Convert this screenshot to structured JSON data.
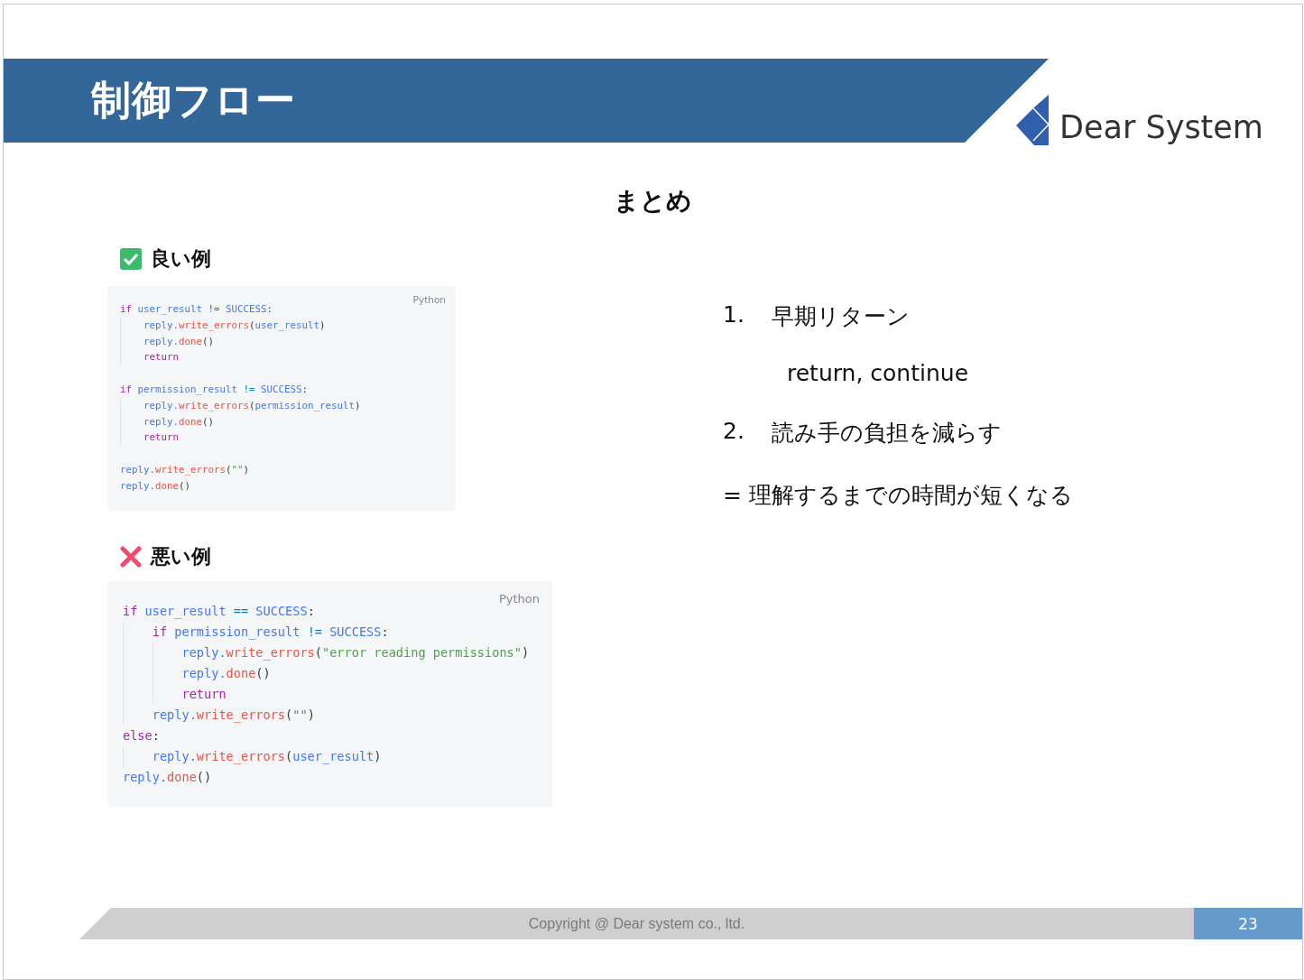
{
  "header": {
    "title": "制御フロー",
    "logo_text": "Dear System"
  },
  "heading": "まとめ",
  "examples": [
    {
      "kind": "good",
      "label": "良い例",
      "language": "Python",
      "lines": [
        {
          "kind": "code",
          "tokens": [
            {
              "kind": "keyword",
              "text": "if "
            },
            {
              "kind": "name",
              "text": "user_result "
            },
            {
              "kind": "operator",
              "text": "!= "
            },
            {
              "kind": "name",
              "text": "SUCCESS"
            },
            {
              "kind": "punct",
              "text": ":"
            }
          ],
          "children": [
            {
              "kind": "code",
              "tokens": [
                {
                  "kind": "name",
                  "text": "reply."
                },
                {
                  "kind": "function",
                  "text": "write_errors"
                },
                {
                  "kind": "punct",
                  "text": "("
                },
                {
                  "kind": "name",
                  "text": "user_result"
                },
                {
                  "kind": "punct",
                  "text": ")"
                }
              ]
            },
            {
              "kind": "code",
              "tokens": [
                {
                  "kind": "name",
                  "text": "reply."
                },
                {
                  "kind": "function",
                  "text": "done"
                },
                {
                  "kind": "punct",
                  "text": "()"
                }
              ]
            },
            {
              "kind": "code",
              "tokens": [
                {
                  "kind": "keyword",
                  "text": "return"
                }
              ]
            }
          ]
        },
        {
          "kind": "blank"
        },
        {
          "kind": "code",
          "tokens": [
            {
              "kind": "keyword",
              "text": "if "
            },
            {
              "kind": "name",
              "text": "permission_result "
            },
            {
              "kind": "operator",
              "text": "!= "
            },
            {
              "kind": "name",
              "text": "SUCCESS"
            },
            {
              "kind": "punct",
              "text": ":"
            }
          ],
          "children": [
            {
              "kind": "code",
              "tokens": [
                {
                  "kind": "name",
                  "text": "reply."
                },
                {
                  "kind": "function",
                  "text": "write_errors"
                },
                {
                  "kind": "punct",
                  "text": "("
                },
                {
                  "kind": "name",
                  "text": "permission_result"
                },
                {
                  "kind": "punct",
                  "text": ")"
                }
              ]
            },
            {
              "kind": "code",
              "tokens": [
                {
                  "kind": "name",
                  "text": "reply."
                },
                {
                  "kind": "function",
                  "text": "done"
                },
                {
                  "kind": "punct",
                  "text": "()"
                }
              ]
            },
            {
              "kind": "code",
              "tokens": [
                {
                  "kind": "keyword",
                  "text": "return"
                }
              ]
            }
          ]
        },
        {
          "kind": "blank"
        },
        {
          "kind": "code",
          "tokens": [
            {
              "kind": "name",
              "text": "reply."
            },
            {
              "kind": "function",
              "text": "write_errors"
            },
            {
              "kind": "punct",
              "text": "("
            },
            {
              "kind": "string",
              "text": "\"\""
            },
            {
              "kind": "punct",
              "text": ")"
            }
          ]
        },
        {
          "kind": "code",
          "tokens": [
            {
              "kind": "name",
              "text": "reply."
            },
            {
              "kind": "function",
              "text": "done"
            },
            {
              "kind": "punct",
              "text": "()"
            }
          ]
        }
      ]
    },
    {
      "kind": "bad",
      "label": "悪い例",
      "language": "Python",
      "lines": [
        {
          "kind": "code",
          "tokens": [
            {
              "kind": "keyword",
              "text": "if "
            },
            {
              "kind": "name",
              "text": "user_result "
            },
            {
              "kind": "operator",
              "text": "== "
            },
            {
              "kind": "name",
              "text": "SUCCESS"
            },
            {
              "kind": "punct",
              "text": ":"
            }
          ],
          "children": [
            {
              "kind": "code",
              "tokens": [
                {
                  "kind": "keyword",
                  "text": "if "
                },
                {
                  "kind": "name",
                  "text": "permission_result "
                },
                {
                  "kind": "operator",
                  "text": "!= "
                },
                {
                  "kind": "name",
                  "text": "SUCCESS"
                },
                {
                  "kind": "punct",
                  "text": ":"
                }
              ],
              "children": [
                {
                  "kind": "code",
                  "tokens": [
                    {
                      "kind": "name",
                      "text": "reply."
                    },
                    {
                      "kind": "function",
                      "text": "write_errors"
                    },
                    {
                      "kind": "punct",
                      "text": "("
                    },
                    {
                      "kind": "string",
                      "text": "\"error reading permissions\""
                    },
                    {
                      "kind": "punct",
                      "text": ")"
                    }
                  ]
                },
                {
                  "kind": "code",
                  "tokens": [
                    {
                      "kind": "name",
                      "text": "reply."
                    },
                    {
                      "kind": "function",
                      "text": "done"
                    },
                    {
                      "kind": "punct",
                      "text": "()"
                    }
                  ]
                },
                {
                  "kind": "code",
                  "tokens": [
                    {
                      "kind": "keyword",
                      "text": "return"
                    }
                  ]
                }
              ]
            },
            {
              "kind": "code",
              "tokens": [
                {
                  "kind": "name",
                  "text": "reply."
                },
                {
                  "kind": "function",
                  "text": "write_errors"
                },
                {
                  "kind": "punct",
                  "text": "("
                },
                {
                  "kind": "string",
                  "text": "\"\""
                },
                {
                  "kind": "punct",
                  "text": ")"
                }
              ]
            }
          ]
        },
        {
          "kind": "code",
          "tokens": [
            {
              "kind": "keyword",
              "text": "else"
            },
            {
              "kind": "punct",
              "text": ":"
            }
          ],
          "children": [
            {
              "kind": "code",
              "tokens": [
                {
                  "kind": "name",
                  "text": "reply."
                },
                {
                  "kind": "function",
                  "text": "write_errors"
                },
                {
                  "kind": "punct",
                  "text": "("
                },
                {
                  "kind": "name",
                  "text": "user_result"
                },
                {
                  "kind": "punct",
                  "text": ")"
                }
              ]
            }
          ]
        },
        {
          "kind": "code",
          "tokens": [
            {
              "kind": "name",
              "text": "reply."
            },
            {
              "kind": "function",
              "text": "done"
            },
            {
              "kind": "punct",
              "text": "()"
            }
          ]
        }
      ]
    }
  ],
  "points": [
    {
      "kind": "numbered",
      "number": "1.",
      "text": "早期リターン"
    },
    {
      "kind": "sub",
      "text": "return, continue"
    },
    {
      "kind": "numbered",
      "number": "2.",
      "text": "読み手の負担を減らす"
    },
    {
      "kind": "plain",
      "text": "= 理解するまでの時間が短くなる"
    }
  ],
  "footer": {
    "copyright": "Copyright @ Dear system co., ltd.",
    "page": "23"
  }
}
